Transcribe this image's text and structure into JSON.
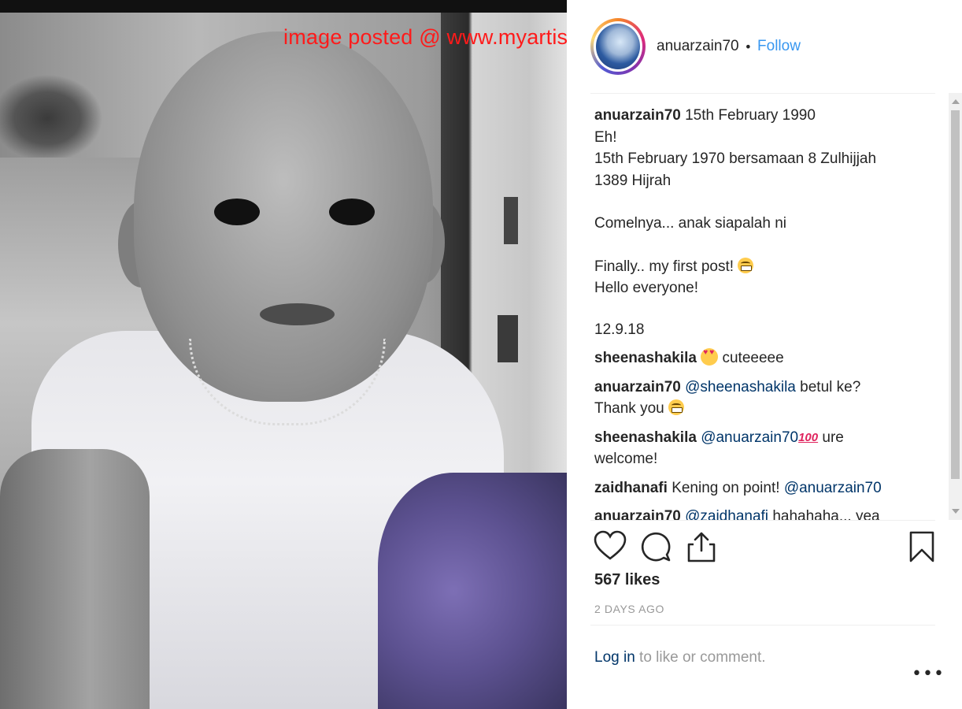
{
  "watermark": "image posted @ www.myartis.com",
  "post": {
    "username": "anuarzain70",
    "separator_dot": "•",
    "follow_label": "Follow",
    "caption": {
      "username": "anuarzain70",
      "line1": "15th February 1990",
      "line2": "Eh!",
      "line3": "15th February 1970 bersamaan 8 Zulhijjah",
      "line4": "1389 Hijrah",
      "line5": "Comelnya... anak siapalah ni",
      "line6": "Finally.. my first post!",
      "line7": "Hello everyone!",
      "line8": "12.9.18"
    },
    "comments": [
      {
        "username": "sheenashakila",
        "text": "cuteeeee",
        "emoji": "heart-eyes"
      },
      {
        "username": "anuarzain70",
        "mention": "@sheenashakila",
        "text": "betul ke?",
        "text2": "Thank you",
        "emoji": "grin"
      },
      {
        "username": "sheenashakila",
        "mention": "@anuarzain70",
        "emoji": "100",
        "text": "ure",
        "text2": "welcome!"
      },
      {
        "username": "zaidhanafi",
        "text": "Kening on point!",
        "mention": "@anuarzain70"
      },
      {
        "username": "anuarzain70",
        "mention": "@zaidhanafi",
        "text": "hahahaha... yea"
      }
    ],
    "likes": "567 likes",
    "time_ago": "2 DAYS AGO",
    "login": {
      "link": "Log in",
      "rest": " to like or comment."
    },
    "more_label": "•••",
    "icons": {
      "like": "heart-outline-icon",
      "comment": "speech-bubble-icon",
      "share": "share-upload-icon",
      "save": "bookmark-icon"
    },
    "colors": {
      "link_blue": "#3897f0",
      "mention_navy": "#003569",
      "text": "#262626",
      "muted": "#999999",
      "watermark_red": "#ff1a1a"
    }
  }
}
